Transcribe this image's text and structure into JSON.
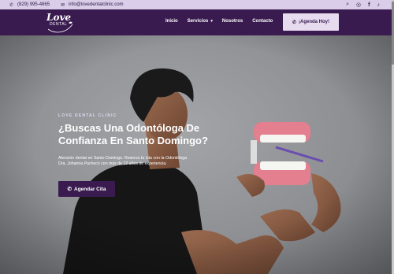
{
  "topbar": {
    "phone": "(829) 995-4865",
    "email": "info@lovedentalclinic.com",
    "phone_icon": "phone-icon",
    "email_icon": "mail-icon",
    "social": [
      "search-icon",
      "instagram-icon",
      "facebook-icon",
      "tiktok-icon"
    ]
  },
  "brand": {
    "logo_line1": "Love",
    "logo_line2": "DENTAL"
  },
  "nav": {
    "inicio": "Inicio",
    "servicios": "Servicios",
    "nosotros": "Nosotros",
    "contacto": "Contacto",
    "cta": "¡Agenda Hoy!"
  },
  "hero": {
    "eyebrow": "LOVE DENTAL CLINIC",
    "headline": "¿Buscas Una Odontóloga De Confianza En Santo Domingo?",
    "description": "Atención dental en Santo Domingo. Reserva tu cita con la Odontóloga Dra. Johanna Pacheco con más de 12 años de experiencia.",
    "button": "Agendar Cita"
  },
  "colors": {
    "brand_purple": "#391b4f",
    "topbar_bg": "#d9cdea",
    "cta_bg": "#e6dbef"
  }
}
